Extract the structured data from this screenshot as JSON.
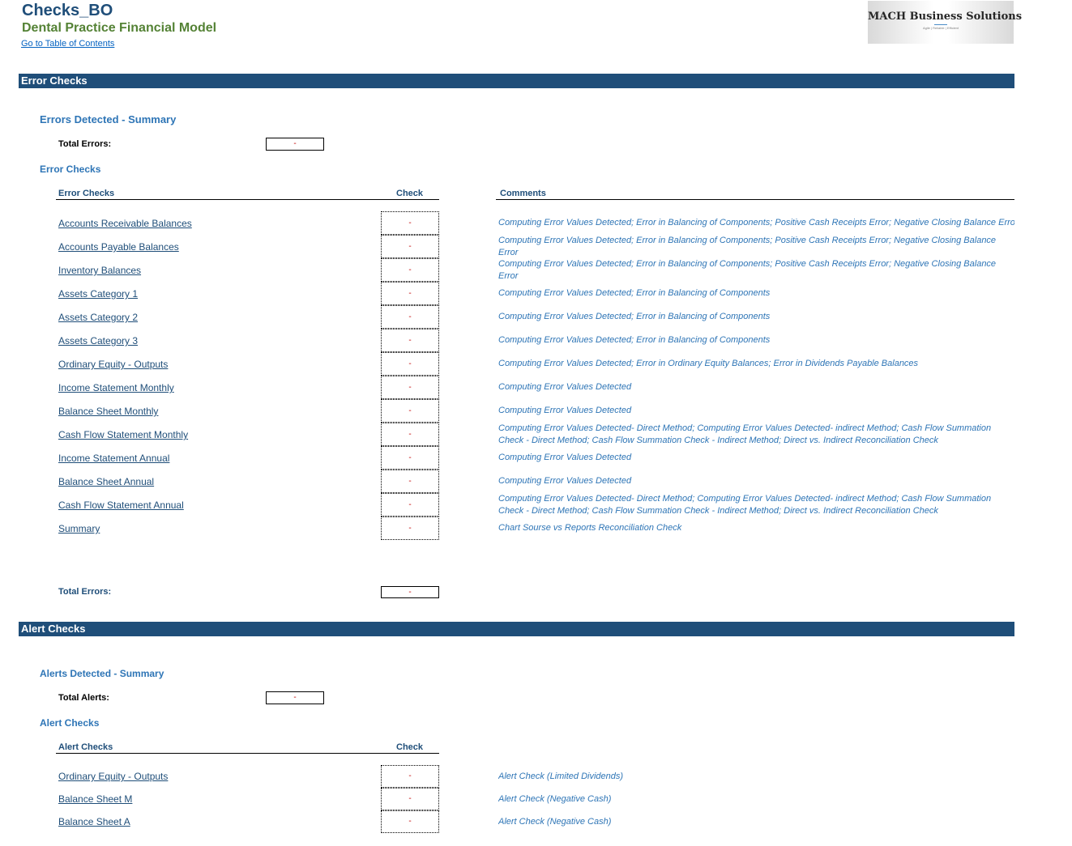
{
  "header": {
    "sheet_title": "Checks_BO",
    "subtitle": "Dental Practice Financial Model",
    "toc_link": "Go to Table of Contents",
    "logo_name": "MACH Business Solutions",
    "logo_tagline": "Agile | Reliable | Efficient"
  },
  "error_section": {
    "banner": "Error Checks",
    "summary_heading": "Errors Detected - Summary",
    "summary_total_label": "Total Errors:",
    "summary_total_value": "-",
    "checks_heading": "Error Checks",
    "col_name": "Error Checks",
    "col_check": "Check",
    "col_comments": "Comments",
    "rows": [
      {
        "label": "Accounts Receivable Balances",
        "check": "-",
        "comment": "Computing Error Values Detected; Error in Balancing of Components; Positive Cash Receipts Error; Negative Closing Balance Error"
      },
      {
        "label": "Accounts Payable Balances ",
        "check": "-",
        "comment": "Computing Error Values Detected; Error in Balancing of Components; Positive Cash Receipts Error; Negative Closing Balance Error"
      },
      {
        "label": "Inventory Balances",
        "check": "-",
        "comment": "Computing Error Values Detected; Error in Balancing of Components; Positive Cash Receipts Error; Negative Closing Balance Error"
      },
      {
        "label": "Assets Category 1",
        "check": "-",
        "comment": "Computing Error Values Detected; Error in Balancing of Components"
      },
      {
        "label": "Assets Category 2",
        "check": "-",
        "comment": "Computing Error Values Detected; Error in Balancing of Components"
      },
      {
        "label": "Assets Category 3",
        "check": "-",
        "comment": "Computing Error Values Detected; Error in Balancing of Components"
      },
      {
        "label": "Ordinary Equity - Outputs",
        "check": "-",
        "comment": "Computing Error Values Detected; Error in Ordinary Equity Balances; Error in Dividends Payable Balances"
      },
      {
        "label": "Income Statement Monthly",
        "check": "-",
        "comment": "Computing Error Values Detected"
      },
      {
        "label": "Balance Sheet Monthly",
        "check": "-",
        "comment": "Computing Error Values Detected"
      },
      {
        "label": "Cash Flow Statement Monthly",
        "check": "-",
        "comment": "Computing Error Values Detected- Direct Method; Computing Error Values Detected- indirect Method; Cash Flow Summation Check - Direct Method; Cash Flow Summation Check - Indirect Method; Direct vs. Indirect Reconciliation Check"
      },
      {
        "label": "Income Statement Annual",
        "check": "-",
        "comment": "Computing Error Values Detected"
      },
      {
        "label": "Balance Sheet Annual",
        "check": "-",
        "comment": "Computing Error Values Detected"
      },
      {
        "label": "Cash Flow Statement Annual",
        "check": "-",
        "comment": "Computing Error Values Detected- Direct Method; Computing Error Values Detected- indirect Method; Cash Flow Summation Check - Direct Method; Cash Flow Summation Check - Indirect Method; Direct vs. Indirect Reconciliation Check"
      },
      {
        "label": "Summary",
        "check": "-",
        "comment": "Chart Sourse vs Reports Reconciliation Check"
      }
    ],
    "footer_total_label": "Total Errors:",
    "footer_total_value": "-"
  },
  "alert_section": {
    "banner": "Alert Checks",
    "summary_heading": "Alerts Detected - Summary",
    "summary_total_label": "Total Alerts:",
    "summary_total_value": "-",
    "checks_heading": "Alert Checks",
    "col_name": "Alert Checks",
    "col_check": "Check",
    "rows": [
      {
        "label": "Ordinary Equity - Outputs",
        "check": "-",
        "comment": "Alert Check (Limited Dividends)"
      },
      {
        "label": "Balance Sheet M",
        "check": "-",
        "comment": "Alert Check (Negative Cash)"
      },
      {
        "label": "Balance Sheet A",
        "check": "-",
        "comment": "Alert Check (Negative Cash)"
      }
    ]
  }
}
